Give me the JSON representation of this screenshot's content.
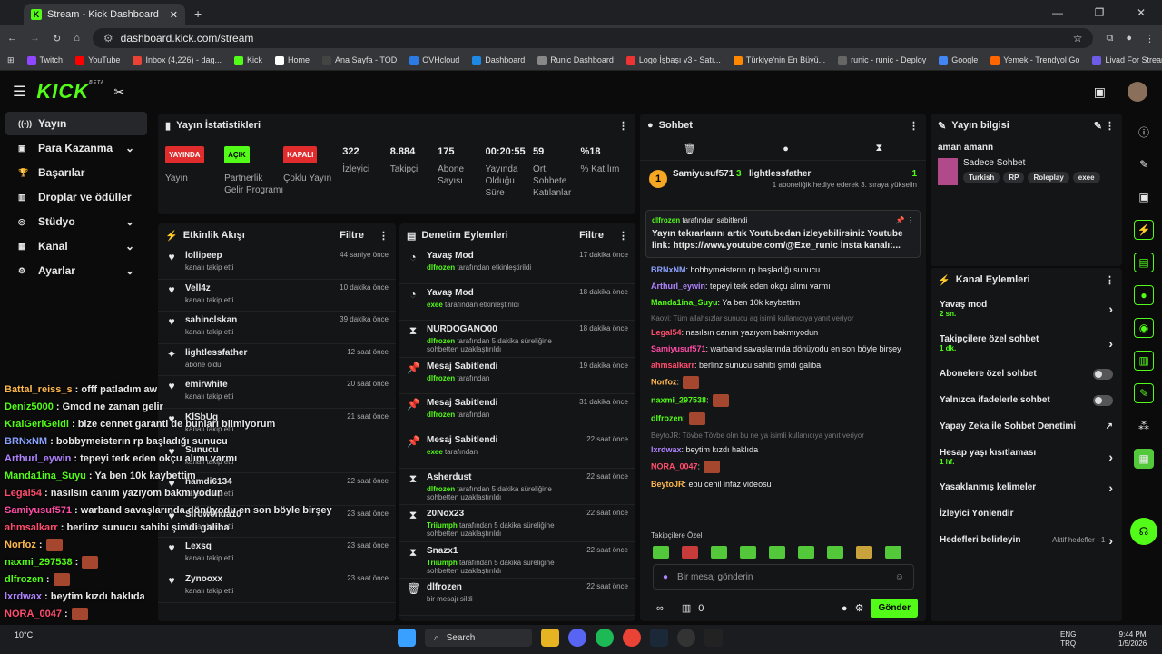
{
  "browser": {
    "tab_title": "Stream - Kick Dashboard",
    "url": "dashboard.kick.com/stream",
    "bookmarks": [
      "Twitch",
      "YouTube",
      "Inbox (4,226) - dag...",
      "Kick",
      "Home",
      "Ana Sayfa - TOD",
      "OVHcloud",
      "Dashboard",
      "Runic Dashboard",
      "Logo İşbaşı v3 - Satı...",
      "Türkiye'nin En Büyü...",
      "runic - runic - Deploy",
      "Google",
      "Yemek - Trendyol Go",
      "Livad For Streamers"
    ]
  },
  "brand": {
    "logo": "KICK",
    "beta": "BETA"
  },
  "sidebar": {
    "items": [
      {
        "label": "Yayın",
        "icon": "broadcast-icon"
      },
      {
        "label": "Para Kazanma",
        "icon": "money-icon"
      },
      {
        "label": "Başarılar",
        "icon": "trophy-icon"
      },
      {
        "label": "Droplar ve ödüller",
        "icon": "gift-icon"
      },
      {
        "label": "Stüdyo",
        "icon": "studio-icon"
      },
      {
        "label": "Kanal",
        "icon": "channel-icon"
      },
      {
        "label": "Ayarlar",
        "icon": "gear-icon"
      }
    ]
  },
  "stats": {
    "title": "Yayın İstatistikleri",
    "badges": [
      {
        "badge": "YAYINDA",
        "label": "Yayın",
        "color": "#e02c2c"
      },
      {
        "badge": "AÇIK",
        "label": "Partnerlik Gelir Programı",
        "color": "#53fc18"
      },
      {
        "badge": "KAPALI",
        "label": "Çoklu Yayın",
        "color": "#e02c2c"
      }
    ],
    "metrics": [
      {
        "value": "322",
        "label": "İzleyici"
      },
      {
        "value": "8.884",
        "label": "Takipçi"
      },
      {
        "value": "175",
        "label": "Abone Sayısı"
      },
      {
        "value": "00:20:55",
        "label": "Yayında Olduğu Süre"
      },
      {
        "value": "59",
        "label": "Ort. Sohbete Katılanlar"
      },
      {
        "value": "%18",
        "label": "% Katılım"
      }
    ]
  },
  "activity": {
    "title": "Etkinlik Akışı",
    "filter": "Filtre",
    "items": [
      {
        "name": "lollipeep",
        "sub": "kanalı takip etti",
        "time": "44 saniye önce",
        "icon": "♥"
      },
      {
        "name": "Vell4z",
        "sub": "kanalı takip etti",
        "time": "10 dakika önce",
        "icon": "♥"
      },
      {
        "name": "sahinclskan",
        "sub": "kanalı takip etti",
        "time": "39 dakika önce",
        "icon": "♥"
      },
      {
        "name": "lightlessfather",
        "sub": "abone oldu",
        "time": "12 saat önce",
        "icon": "✦"
      },
      {
        "name": "emirwhite",
        "sub": "kanalı takip etti",
        "time": "20 saat önce",
        "icon": "♥"
      },
      {
        "name": "KlSbUg",
        "sub": "kanalı takip etti",
        "time": "21 saat önce",
        "icon": "♥"
      },
      {
        "name": "Sunucu",
        "sub": "kanalı takip etti",
        "time": "",
        "icon": "♥"
      },
      {
        "name": "hamdi6134",
        "sub": "kanalı takip etti",
        "time": "22 saat önce",
        "icon": "♥"
      },
      {
        "name": "Sirowenda10",
        "sub": "kanalı takip etti",
        "time": "23 saat önce",
        "icon": "♥"
      },
      {
        "name": "Lexsq",
        "sub": "kanalı takip etti",
        "time": "23 saat önce",
        "icon": "♥"
      },
      {
        "name": "Zynooxx",
        "sub": "kanalı takip etti",
        "time": "23 saat önce",
        "icon": "♥"
      }
    ]
  },
  "moderation": {
    "title": "Denetim Eylemleri",
    "filter": "Filtre",
    "items": [
      {
        "name": "Yavaş Mod",
        "by": "dlfrozen",
        "rest": " tarafından etkinleştirildi",
        "time": "17 dakika önce",
        "icon": "◔"
      },
      {
        "name": "Yavaş Mod",
        "by": "exee",
        "rest": " tarafından etkinleştirildi",
        "time": "18 dakika önce",
        "icon": "◔"
      },
      {
        "name": "NURDOGANO00",
        "by": "dlfrozen",
        "rest": " tarafından 5 dakika süreliğine sohbetten uzaklaştırıldı",
        "time": "18 dakika önce",
        "icon": "⧗"
      },
      {
        "name": "Mesaj Sabitlendi",
        "by": "dlfrozen",
        "rest": " tarafından",
        "time": "19 dakika önce",
        "icon": "📌"
      },
      {
        "name": "Mesaj Sabitlendi",
        "by": "dlfrozen",
        "rest": " tarafından",
        "time": "31 dakika önce",
        "icon": "📌"
      },
      {
        "name": "Mesaj Sabitlendi",
        "by": "exee",
        "rest": " tarafından",
        "time": "22 saat önce",
        "icon": "📌"
      },
      {
        "name": "Asherdust",
        "by": "dlfrozen",
        "rest": " tarafından 5 dakika süreliğine sohbetten uzaklaştırıldı",
        "time": "22 saat önce",
        "icon": "⧗"
      },
      {
        "name": "20Nox23",
        "by": "Triiumph",
        "rest": " tarafından 5 dakika süreliğine sohbetten uzaklaştırıldı",
        "time": "22 saat önce",
        "icon": "⧗"
      },
      {
        "name": "Snazx1",
        "by": "Triiumph",
        "rest": " tarafından 5 dakika süreliğine sohbetten uzaklaştırıldı",
        "time": "22 saat önce",
        "icon": "⧗"
      },
      {
        "name": "dlfrozen",
        "by": "",
        "rest": "bir mesajı sildi",
        "time": "22 saat önce",
        "icon": "🗑"
      }
    ]
  },
  "chat": {
    "title": "Sohbet",
    "top_gifter": "Samiyusuf571",
    "top_gifter_count": "3",
    "gift_user": "lightlessfather",
    "gift_count": "1",
    "gift_text": "1 aboneliğik hediye ederek 3. sıraya yükselin",
    "pinned_by": "dlfrozen",
    "pinned_suffix": "tarafından sabitlendi",
    "pinned_text": "Yayın tekrarlarını artık Youtubedan izleyebilirsiniz Youtube link: https://www.youtube.com/@Exe_runic İnsta kanalı:...",
    "messages": [
      {
        "user": "BRNxNM",
        "color": "#8aa2ff",
        "text": ": bobbymeisterın rp başladığı sunucu"
      },
      {
        "user": "Arthurl_eywin",
        "color": "#b084ff",
        "text": ": tepeyi terk eden okçu alımı varmı"
      },
      {
        "user": "Manda1ina_Suyu",
        "color": "#53fc18",
        "text": ": Ya ben 10k kaybettim"
      },
      {
        "user": "Legal54",
        "color": "#ff4d6d",
        "text": ": nasılsın canım yazıyom bakmıyodun",
        "reply": "Kaovi: Tüm allahsızlar sunucu aq isimli kullanıcıya yanıt veriyor"
      },
      {
        "user": "Samiyusuf571",
        "color": "#ff4da6",
        "text": ": warband savaşlarında dönüyodu en son böyle birşey"
      },
      {
        "user": "ahmsalkarr",
        "color": "#ff4d6d",
        "text": ": berlinz sunucu sahibi şimdi galiba"
      },
      {
        "user": "Norfoz",
        "color": "#ffb84d",
        "text": ":"
      },
      {
        "user": "naxmi_297538",
        "color": "#53fc18",
        "text": ":"
      },
      {
        "user": "dlfrozen",
        "color": "#53fc18",
        "text": ":"
      },
      {
        "user": "lxrdwax",
        "color": "#b084ff",
        "text": ": beytim kızdı haklıda",
        "reply": "BeytoJR: Tövbe Tövbe olm bu ne ya isimli kullanıcıya yanıt veriyor"
      },
      {
        "user": "NORA_0047",
        "color": "#ff4d6d",
        "text": ":"
      },
      {
        "user": "BeytoJR",
        "color": "#ffb84d",
        "text": ": ebu cehil infaz videosu"
      }
    ],
    "followers_only": "Takipçilere Özel",
    "placeholder": "Bir mesaj gönderin",
    "send": "Gönder",
    "viewers": "0"
  },
  "info": {
    "title": "Yayın bilgisi",
    "stream_title": "aman amann",
    "category": "Sadece Sohbet",
    "tags": [
      "Turkish",
      "RP",
      "Roleplay",
      "exee"
    ]
  },
  "actions": {
    "title": "Kanal Eylemleri",
    "items": [
      {
        "label": "Yavaş mod",
        "sub": "2 sn.",
        "ctl": "chev"
      },
      {
        "label": "Takipçilere özel sohbet",
        "sub": "1 dk.",
        "ctl": "chev"
      },
      {
        "label": "Abonelere özel sohbet",
        "sub": "",
        "ctl": "toggle"
      },
      {
        "label": "Yalnızca ifadelerle sohbet",
        "sub": "",
        "ctl": "toggle"
      },
      {
        "label": "Yapay Zeka ile Sohbet Denetimi",
        "sub": "",
        "ctl": "ext"
      },
      {
        "label": "Hesap yaşı kısıtlaması",
        "sub": "1 hf.",
        "ctl": "chev"
      },
      {
        "label": "Yasaklanmış kelimeler",
        "sub": "",
        "ctl": "chev"
      },
      {
        "label": "İzleyici Yönlendir",
        "sub": "",
        "ctl": ""
      },
      {
        "label": "Hedefleri belirleyin",
        "sub": "",
        "ctl": "chev",
        "extra": "Aktif hedefler - 1"
      }
    ]
  },
  "overlay": {
    "lines": [
      {
        "u": "Battal_reiss_s",
        "c": "#ffb84d",
        "t": " : offf patladım aw"
      },
      {
        "u": "Deniz5000",
        "c": "#53fc18",
        "t": " : Gmod ne zaman gelir"
      },
      {
        "u": "KralGeriGeldi",
        "c": "#53fc18",
        "t": " : bize cennet garanti de bunları bilmiyorum"
      },
      {
        "u": "BRNxNM",
        "c": "#8aa2ff",
        "t": " : bobbymeisterın rp başladığı sunucu"
      },
      {
        "u": "Arthurl_eywin",
        "c": "#b084ff",
        "t": " : tepeyi terk eden okçu alımı varmı"
      },
      {
        "u": "Manda1ina_Suyu",
        "c": "#53fc18",
        "t": " : Ya ben 10k kaybettim"
      },
      {
        "u": "Legal54",
        "c": "#ff4d6d",
        "t": " : nasılsın canım yazıyom bakmıyodun"
      },
      {
        "u": "Samiyusuf571",
        "c": "#ff4da6",
        "t": " : warband savaşlarında dönüyodu en son böyle birşey"
      },
      {
        "u": "ahmsalkarr",
        "c": "#ff4d6d",
        "t": " : berlinz sunucu sahibi şimdi galiba"
      },
      {
        "u": "Norfoz",
        "c": "#ffb84d",
        "t": " :"
      },
      {
        "u": "naxmi_297538",
        "c": "#53fc18",
        "t": " :"
      },
      {
        "u": "dlfrozen",
        "c": "#53fc18",
        "t": " :"
      },
      {
        "u": "lxrdwax",
        "c": "#b084ff",
        "t": " : beytim kızdı haklıda"
      },
      {
        "u": "NORA_0047",
        "c": "#ff4d6d",
        "t": " :"
      },
      {
        "u": "BeytoJR",
        "c": "#ffb84d",
        "t": " : ebu cehil infaz videosu"
      }
    ]
  },
  "taskbar": {
    "search": "Search",
    "weather": "10°C",
    "lang": "ENG",
    "lang2": "TRQ",
    "time": "9:44 PM",
    "date": "1/5/2026"
  }
}
